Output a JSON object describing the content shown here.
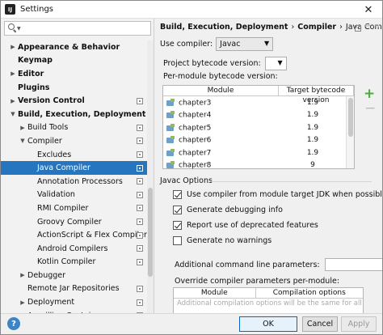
{
  "window": {
    "title": "Settings",
    "app_icon_text": "IJ",
    "close_glyph": "✕"
  },
  "search": {
    "value": "",
    "placeholder": ""
  },
  "tree": [
    {
      "label": "Appearance & Behavior",
      "level": 0,
      "bold": true,
      "arrow": "▶",
      "proj": false
    },
    {
      "label": "Keymap",
      "level": 0,
      "bold": true,
      "arrow": "",
      "proj": false
    },
    {
      "label": "Editor",
      "level": 0,
      "bold": true,
      "arrow": "▶",
      "proj": false
    },
    {
      "label": "Plugins",
      "level": 0,
      "bold": true,
      "arrow": "",
      "proj": false
    },
    {
      "label": "Version Control",
      "level": 0,
      "bold": true,
      "arrow": "▶",
      "proj": true
    },
    {
      "label": "Build, Execution, Deployment",
      "level": 0,
      "bold": true,
      "arrow": "▼",
      "proj": false
    },
    {
      "label": "Build Tools",
      "level": 1,
      "bold": false,
      "arrow": "▶",
      "proj": true
    },
    {
      "label": "Compiler",
      "level": 1,
      "bold": false,
      "arrow": "▼",
      "proj": true
    },
    {
      "label": "Excludes",
      "level": 2,
      "bold": false,
      "arrow": "",
      "proj": true
    },
    {
      "label": "Java Compiler",
      "level": 2,
      "bold": false,
      "arrow": "",
      "proj": true,
      "selected": true
    },
    {
      "label": "Annotation Processors",
      "level": 2,
      "bold": false,
      "arrow": "",
      "proj": true
    },
    {
      "label": "Validation",
      "level": 2,
      "bold": false,
      "arrow": "",
      "proj": true
    },
    {
      "label": "RMI Compiler",
      "level": 2,
      "bold": false,
      "arrow": "",
      "proj": true
    },
    {
      "label": "Groovy Compiler",
      "level": 2,
      "bold": false,
      "arrow": "",
      "proj": true
    },
    {
      "label": "ActionScript & Flex Compiler",
      "level": 2,
      "bold": false,
      "arrow": "",
      "proj": true
    },
    {
      "label": "Android Compilers",
      "level": 2,
      "bold": false,
      "arrow": "",
      "proj": true
    },
    {
      "label": "Kotlin Compiler",
      "level": 2,
      "bold": false,
      "arrow": "",
      "proj": true
    },
    {
      "label": "Debugger",
      "level": 1,
      "bold": false,
      "arrow": "▶",
      "proj": false
    },
    {
      "label": "Remote Jar Repositories",
      "level": 1,
      "bold": false,
      "arrow": "",
      "proj": true
    },
    {
      "label": "Deployment",
      "level": 1,
      "bold": false,
      "arrow": "▶",
      "proj": true
    },
    {
      "label": "Arquillian Containers",
      "level": 1,
      "bold": false,
      "arrow": "",
      "proj": true
    }
  ],
  "breadcrumb": {
    "part1": "Build, Execution, Deployment",
    "sep": "›",
    "part2": "Compiler",
    "part3": "Java Compiler"
  },
  "compiler": {
    "label": "Use compiler:",
    "value": "Javac",
    "dropdown_glyph": "▼"
  },
  "bytecode": {
    "label": "Project bytecode version:",
    "value": "",
    "dropdown_glyph": "▼"
  },
  "per_module": {
    "label": "Per-module bytecode version:",
    "columns": [
      "Module",
      "Target bytecode version"
    ],
    "rows": [
      {
        "module": "chapter3",
        "version": "1.9"
      },
      {
        "module": "chapter4",
        "version": "1.9"
      },
      {
        "module": "chapter5",
        "version": "1.9"
      },
      {
        "module": "chapter6",
        "version": "1.9"
      },
      {
        "module": "chapter7",
        "version": "1.9"
      },
      {
        "module": "chapter8",
        "version": "9"
      }
    ],
    "add_glyph": "+",
    "remove_glyph": "−"
  },
  "javac_options": {
    "title": "Javac Options",
    "checkboxes": [
      {
        "label": "Use compiler from module target JDK when possible",
        "checked": true
      },
      {
        "label": "Generate debugging info",
        "checked": true
      },
      {
        "label": "Report use of deprecated features",
        "checked": true
      },
      {
        "label": "Generate no warnings",
        "checked": false
      }
    ],
    "additional_label": "Additional command line parameters:",
    "additional_value": "",
    "override_label": "Override compiler parameters per-module:",
    "override_columns": [
      "Module",
      "Compilation options"
    ],
    "override_hint": "Additional compilation options will be the same for all modules"
  },
  "buttons": {
    "help": "?",
    "ok": "OK",
    "cancel": "Cancel",
    "apply": "Apply"
  }
}
